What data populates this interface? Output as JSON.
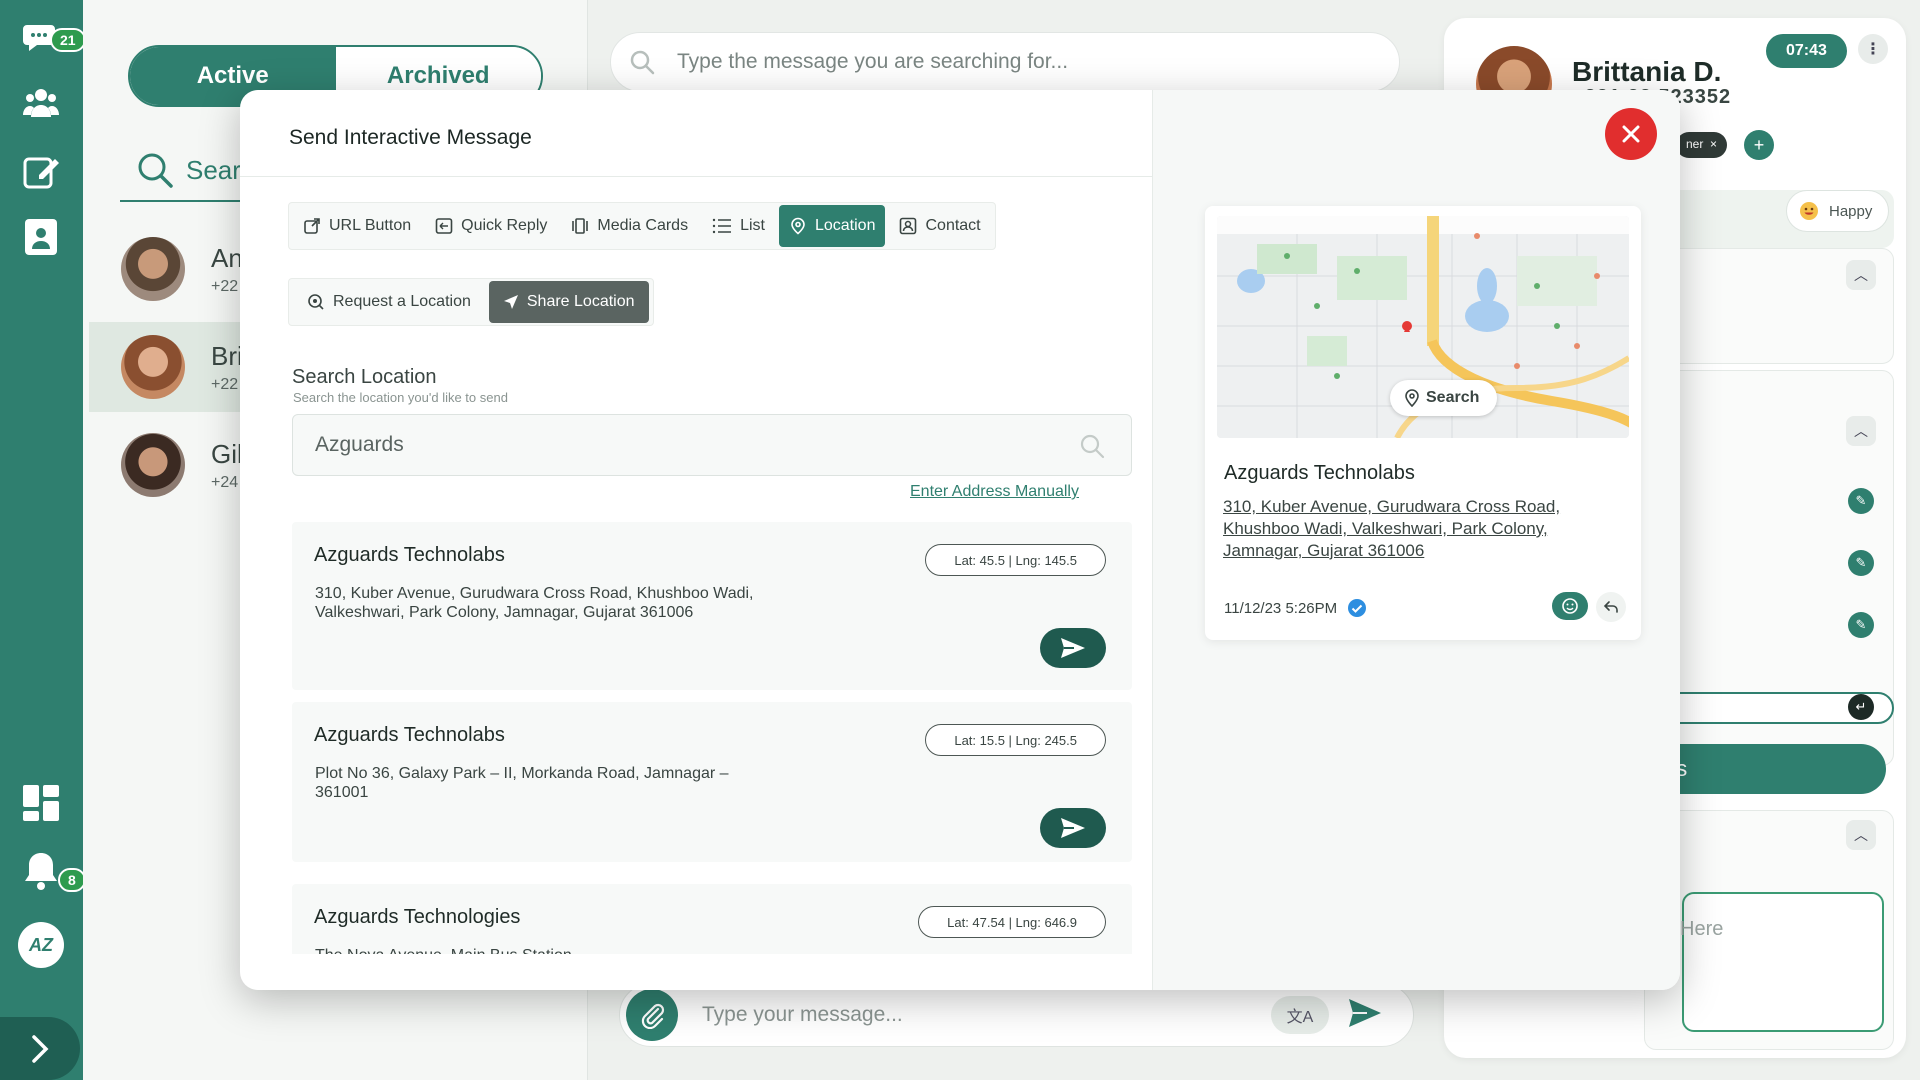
{
  "rail": {
    "chat_badge": "21",
    "bell_badge": "8",
    "avatar_initials": "AZ"
  },
  "list": {
    "tabs": {
      "active": "Active",
      "archived": "Archived"
    },
    "search_placeholder": "Sear",
    "contacts": [
      {
        "name": "An",
        "phone": "+22"
      },
      {
        "name": "Bri",
        "phone": "+22"
      },
      {
        "name": "Gil",
        "phone": "+24"
      }
    ]
  },
  "top_search": {
    "placeholder": "Type the message you are searching for..."
  },
  "profile": {
    "name": "Brittania D.",
    "phone": "+221 22 523352",
    "time": "07:43",
    "tag": "ner",
    "mood": "Happy",
    "button_partial": "es",
    "note_placeholder": "Here"
  },
  "composer": {
    "placeholder": "Type your message..."
  },
  "modal": {
    "title": "Send Interactive Message",
    "type_tabs": [
      {
        "label": "URL Button",
        "icon": "external-link-icon"
      },
      {
        "label": "Quick Reply",
        "icon": "reply-box-icon"
      },
      {
        "label": "Media Cards",
        "icon": "cards-icon"
      },
      {
        "label": "List",
        "icon": "list-icon"
      },
      {
        "label": "Location",
        "icon": "location-icon"
      },
      {
        "label": "Contact",
        "icon": "contact-icon"
      }
    ],
    "sub_tabs": {
      "request": "Request a Location",
      "share": "Share Location"
    },
    "search": {
      "title": "Search Location",
      "hint": "Search the location you'd like to send",
      "value": "Azguards",
      "manual_link": "Enter Address Manually"
    },
    "results": [
      {
        "name": "Azguards Technolabs",
        "address": "310, Kuber Avenue, Gurudwara Cross Road, Khushboo Wadi, Valkeshwari, Park Colony, Jamnagar, Gujarat 361006",
        "geo": "Lat: 45.5 | Lng: 145.5"
      },
      {
        "name": "Azguards Technolabs",
        "address": "Plot No 36, Galaxy Park – II, Morkanda Road, Jamnagar – 361001",
        "geo": "Lat: 15.5 | Lng: 245.5"
      },
      {
        "name": "Azguards Technologies",
        "address": "The Nova Avenue, Main Bus Station",
        "geo": "Lat: 47.54 | Lng: 646.9"
      }
    ],
    "preview": {
      "map_search": "Search",
      "name": "Azguards Technolabs",
      "address": "310, Kuber Avenue, Gurudwara Cross Road, Khushboo Wadi, Valkeshwari, Park Colony, Jamnagar, Gujarat 361006",
      "timestamp": "11/12/23 5:26PM"
    }
  },
  "colors": {
    "brand": "#2f7f6f",
    "brand_dark": "#1f5a4f",
    "danger": "#e12e2e",
    "badge": "#2e9b4e"
  }
}
